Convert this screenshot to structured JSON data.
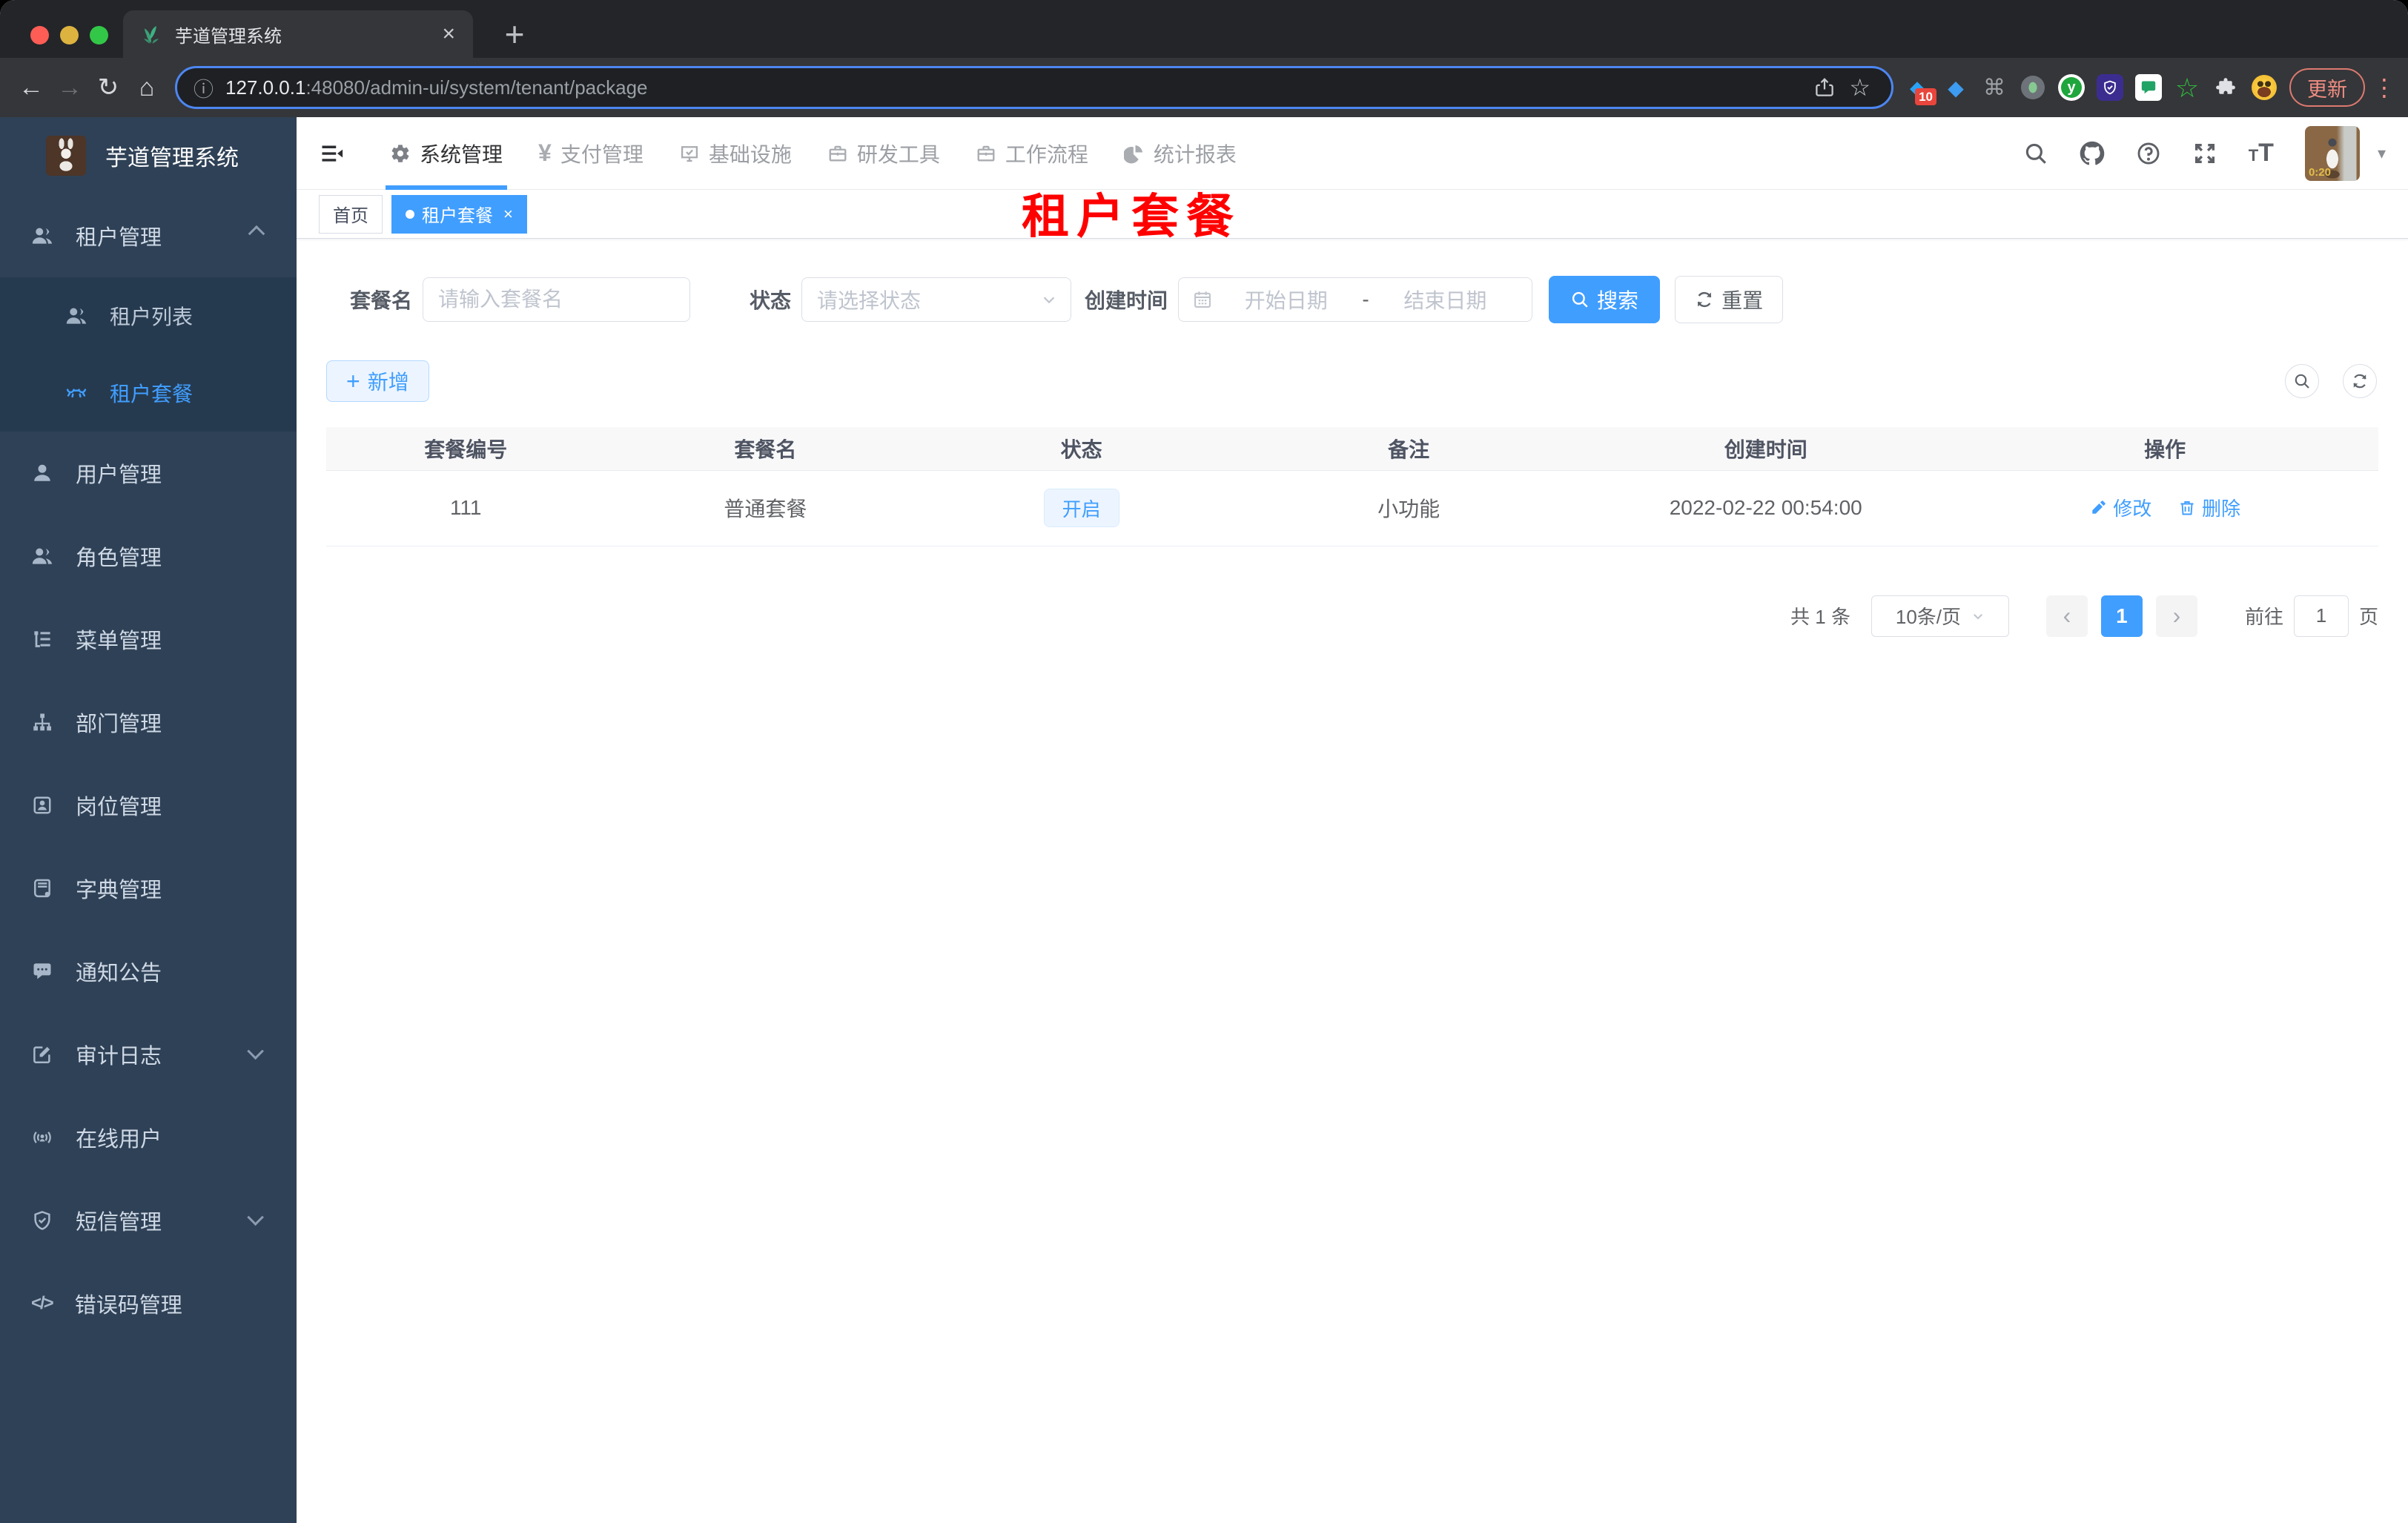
{
  "colors": {
    "primary": "#409eff",
    "sidebar_bg": "#2f4156",
    "overlay_red": "#ff0000"
  },
  "browser": {
    "tab_title": "芋道管理系统",
    "url": {
      "host": "127.0.0.1",
      "rest": ":48080/admin-ui/system/tenant/package"
    },
    "extensions_badge": "10",
    "update_label": "更新"
  },
  "header": {
    "nav": [
      {
        "label": "系统管理",
        "icon": "gear-icon",
        "active": true
      },
      {
        "label": "支付管理",
        "icon": "yen-icon",
        "active": false
      },
      {
        "label": "基础设施",
        "icon": "monitor-icon",
        "active": false
      },
      {
        "label": "研发工具",
        "icon": "briefcase-icon",
        "active": false
      },
      {
        "label": "工作流程",
        "icon": "briefcase-icon",
        "active": false
      },
      {
        "label": "统计报表",
        "icon": "dashboard-icon",
        "active": false
      }
    ],
    "avatar_time": "0:20"
  },
  "sidebar": {
    "title": "芋道管理系统",
    "items": [
      {
        "label": "租户管理",
        "icon": "users-icon",
        "expanded": true
      },
      {
        "label": "租户列表",
        "icon": "users-icon"
      },
      {
        "label": "租户套餐",
        "icon": "glasses-icon",
        "active": true
      },
      {
        "label": "用户管理",
        "icon": "user-icon"
      },
      {
        "label": "角色管理",
        "icon": "users-icon"
      },
      {
        "label": "菜单管理",
        "icon": "tree-icon"
      },
      {
        "label": "部门管理",
        "icon": "org-icon"
      },
      {
        "label": "岗位管理",
        "icon": "badge-icon"
      },
      {
        "label": "字典管理",
        "icon": "book-icon"
      },
      {
        "label": "通知公告",
        "icon": "chat-icon"
      },
      {
        "label": "审计日志",
        "icon": "audit-icon",
        "collapsed": true
      },
      {
        "label": "在线用户",
        "icon": "online-icon"
      },
      {
        "label": "短信管理",
        "icon": "shield-icon",
        "collapsed": true
      },
      {
        "label": "错误码管理",
        "icon": "code-icon"
      }
    ]
  },
  "tags": {
    "items": [
      {
        "label": "首页",
        "active": false
      },
      {
        "label": "租户套餐",
        "active": true
      }
    ]
  },
  "overlay_title": "租户套餐",
  "filters": {
    "name_label": "套餐名",
    "name_placeholder": "请输入套餐名",
    "status_label": "状态",
    "status_placeholder": "请选择状态",
    "date_label": "创建时间",
    "date_start_placeholder": "开始日期",
    "date_separator": "-",
    "date_end_placeholder": "结束日期",
    "search_label": "搜索",
    "reset_label": "重置"
  },
  "toolbar": {
    "add_label": "新增"
  },
  "table": {
    "columns": [
      "套餐编号",
      "套餐名",
      "状态",
      "备注",
      "创建时间",
      "操作"
    ],
    "rows": [
      {
        "id": "111",
        "name": "普通套餐",
        "status": "开启",
        "remark": "小功能",
        "created_at": "2022-02-22 00:54:00",
        "edit_label": "修改",
        "delete_label": "删除"
      }
    ]
  },
  "pagination": {
    "total": "共 1 条",
    "page_size": "10条/页",
    "current_page": "1",
    "goto_label": "前往",
    "goto_value": "1",
    "unit_label": "页"
  }
}
